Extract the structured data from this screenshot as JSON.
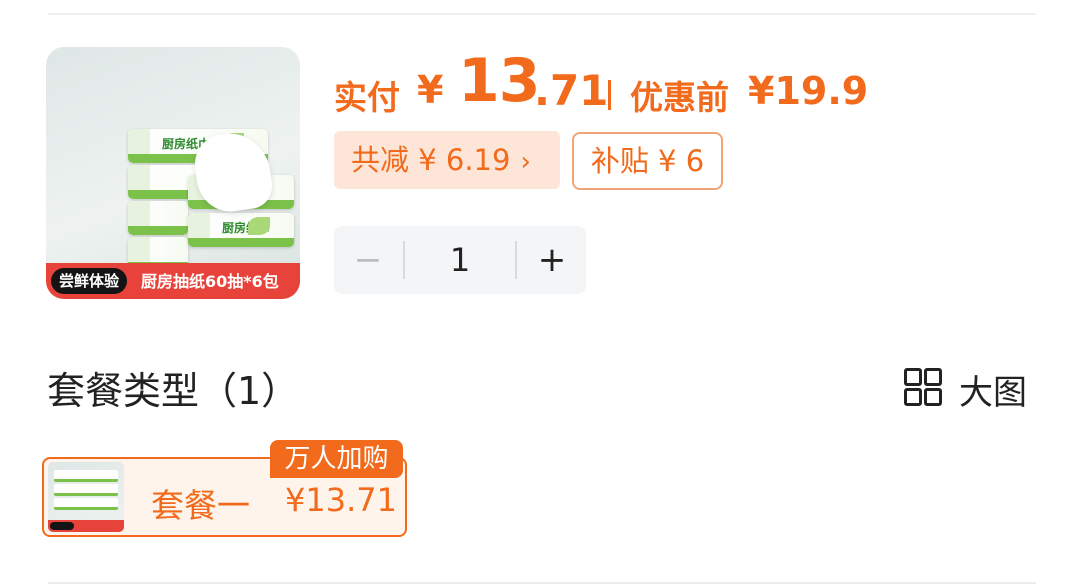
{
  "product": {
    "image_tag": "尝鲜体验",
    "image_desc": "厨房抽纸60抽*6包",
    "pack_brand": "厨房纸巾"
  },
  "price": {
    "pay_label": "实付",
    "currency": "¥",
    "pay_int": "13",
    "pay_dec": ".71",
    "before_label": "优惠前",
    "before_price": "¥19.9"
  },
  "discount": {
    "total_label": "共减 ¥ 6.19",
    "subsidy_label": "补贴 ¥ 6"
  },
  "quantity": {
    "minus": "−",
    "value": "1",
    "plus": "+"
  },
  "section": {
    "title": "套餐类型（1）",
    "view_label": "大图"
  },
  "packages": [
    {
      "name": "套餐一",
      "price": "¥13.71",
      "badge": "万人加购"
    }
  ],
  "colors": {
    "accent": "#f26a1b",
    "chip_bg": "#fde6d8",
    "banner_red": "#e8433a"
  }
}
